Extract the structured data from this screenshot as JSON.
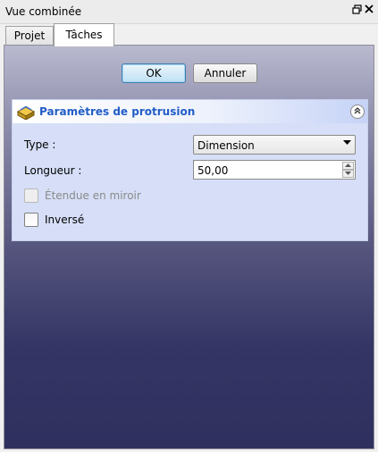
{
  "window": {
    "title": "Vue combinée",
    "restore_icon": "restore-icon",
    "close_icon": "close-icon"
  },
  "tabs": [
    {
      "label": "Projet",
      "active": false
    },
    {
      "label": "Tâches",
      "active": true
    }
  ],
  "actions": {
    "ok_label": "OK",
    "cancel_label": "Annuler"
  },
  "task": {
    "title": "Paramètres de protrusion",
    "icon": "pad-icon",
    "collapse_icon": "collapse-chevrons-icon",
    "type": {
      "label": "Type :",
      "value": "Dimension"
    },
    "length": {
      "label": "Longueur :",
      "value": "50,00"
    },
    "mirrored": {
      "label": "Étendue en miroir",
      "checked": false,
      "enabled": false
    },
    "reversed": {
      "label": "Inversé",
      "checked": false,
      "enabled": true
    }
  },
  "colors": {
    "accent_title": "#215dc6",
    "task_background": "#d6dff7",
    "panel_gradient_top": "#b9b9cf",
    "panel_gradient_bottom": "#30305f"
  }
}
